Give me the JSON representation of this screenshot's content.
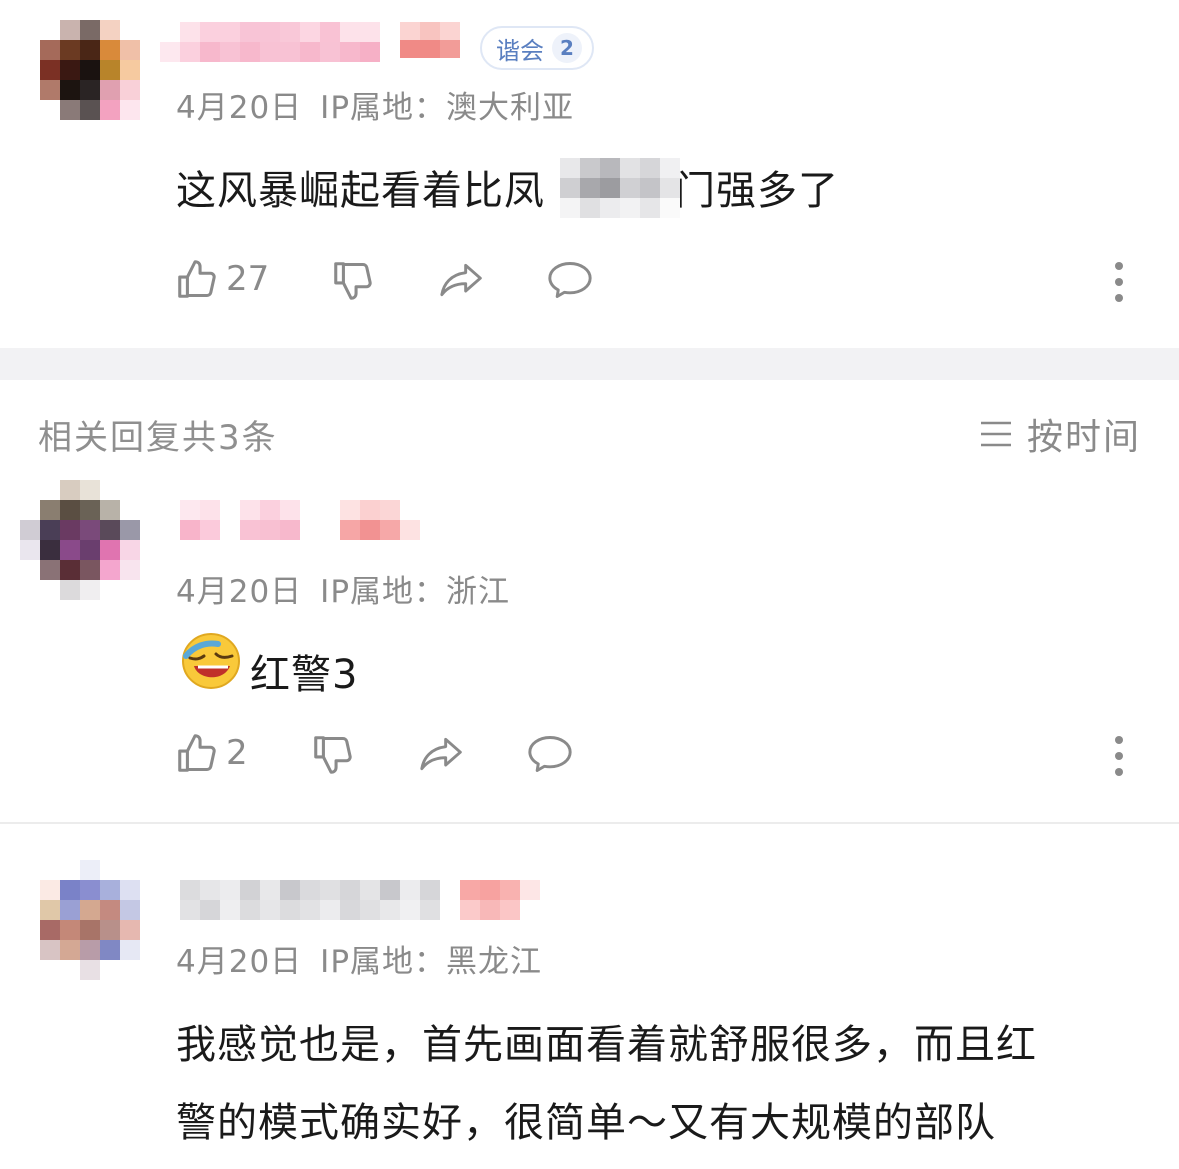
{
  "colors": {
    "meta_text": "#8a8a8a",
    "content_text": "#1a1a1a",
    "badge_text": "#5a7fc0",
    "section_band": "#f2f2f4",
    "censor_pink": "#f7b8cc",
    "censor_red": "#f08a86",
    "censor_gray": "#c9c9cc"
  },
  "main_comment": {
    "badge": {
      "label": "谐会",
      "level": "2"
    },
    "date": "4月20日",
    "ip_location": "IP属地：澳大利亚",
    "text_before": "这风暴崛起看着比凤",
    "text_after": "门强多了",
    "actions": {
      "like_icon": "thumbs-up-icon",
      "like_count": "27",
      "dislike_icon": "thumbs-down-icon",
      "share_icon": "share-icon",
      "reply_icon": "comment-icon",
      "more_icon": "more-vertical-icon"
    }
  },
  "replies_header": {
    "title": "相关回复共3条",
    "sort_icon": "menu-lines-icon",
    "sort_label": "按时间"
  },
  "replies": [
    {
      "date": "4月20日",
      "ip_location": "IP属地：浙江",
      "emoji": "laughing-emoji-icon",
      "text": "红警3",
      "like_count": "2"
    },
    {
      "date": "4月20日",
      "ip_location": "IP属地：黑龙江",
      "text_line1": "我感觉也是，首先画面看着就舒服很多，而且红",
      "text_line2": "警的模式确实好，很简单～又有大规模的部队"
    }
  ]
}
